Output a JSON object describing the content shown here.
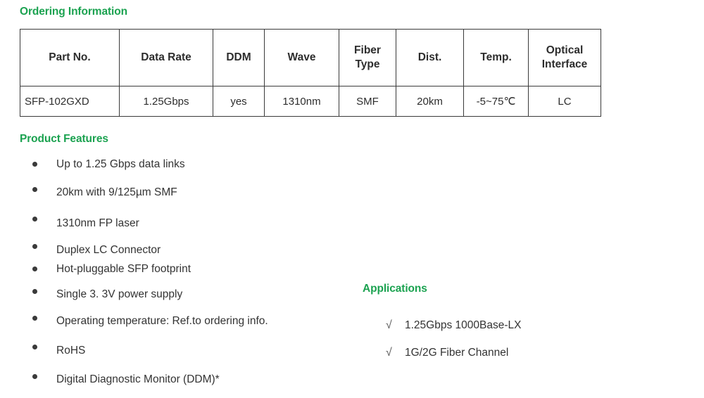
{
  "ordering": {
    "heading": "Ordering Information",
    "table": {
      "headers": [
        "Part No.",
        "Data Rate",
        "DDM",
        "Wave",
        "Fiber\nType",
        "Dist.",
        "Temp.",
        "Optical\nInterface"
      ],
      "headers_display": [
        {
          "line1": "Part No.",
          "line2": ""
        },
        {
          "line1": "Data Rate",
          "line2": ""
        },
        {
          "line1": "DDM",
          "line2": ""
        },
        {
          "line1": "Wave",
          "line2": ""
        },
        {
          "line1": "Fiber",
          "line2": "Type"
        },
        {
          "line1": "Dist.",
          "line2": ""
        },
        {
          "line1": "Temp.",
          "line2": ""
        },
        {
          "line1": "Optical",
          "line2": "Interface"
        }
      ],
      "rows": [
        {
          "part_no": "SFP-102GXD",
          "data_rate": "1.25Gbps",
          "ddm": "yes",
          "wave": "1310nm",
          "fiber_type": "SMF",
          "dist": "20km",
          "temp": "-5~75℃",
          "optical_interface": "LC"
        }
      ]
    }
  },
  "features": {
    "heading": "Product Features",
    "items": [
      "Up to  1.25 Gbps data links",
      "20km with 9/125µm SMF",
      "1310nm FP laser",
      "Duplex LC Connector",
      "Hot-pluggable SFP footprint",
      "Single 3. 3V power supply",
      "Operating temperature: Ref.to ordering info.",
      "RoHS",
      "Digital Diagnostic Monitor (DDM)*"
    ]
  },
  "applications": {
    "heading": "Applications",
    "check_glyph": "√",
    "items": [
      "1.25Gbps 1000Base-LX",
      "1G/2G Fiber Channel"
    ]
  },
  "colors": {
    "heading_green": "#1ba250",
    "body_text": "#333333",
    "table_border": "#3a3a3a",
    "background": "#ffffff"
  }
}
